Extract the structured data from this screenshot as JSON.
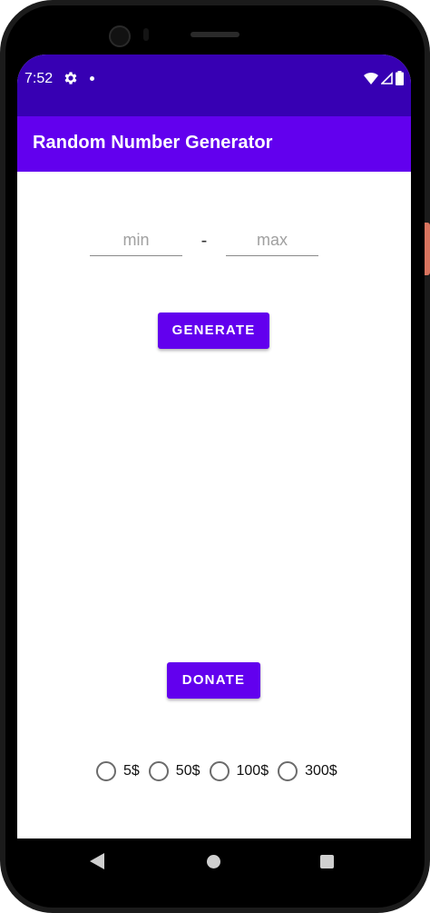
{
  "status_bar": {
    "time": "7:52",
    "icons": [
      "gear-icon",
      "notification-dot-icon",
      "wifi-icon",
      "signal-icon",
      "battery-icon"
    ]
  },
  "app_bar": {
    "title": "Random Number Generator"
  },
  "range": {
    "min_placeholder": "min",
    "max_placeholder": "max",
    "min_value": "",
    "max_value": "",
    "separator": "-"
  },
  "buttons": {
    "generate": "GENERATE",
    "donate": "DONATE"
  },
  "donate_options": [
    {
      "label": "5$",
      "selected": false
    },
    {
      "label": "50$",
      "selected": false
    },
    {
      "label": "100$",
      "selected": false
    },
    {
      "label": "300$",
      "selected": false
    }
  ],
  "colors": {
    "status_bar": "#3700b3",
    "primary": "#6200ee",
    "side_button": "#d9745f"
  },
  "nav_bar": {
    "icons": [
      "back-icon",
      "home-icon",
      "recents-icon"
    ]
  }
}
